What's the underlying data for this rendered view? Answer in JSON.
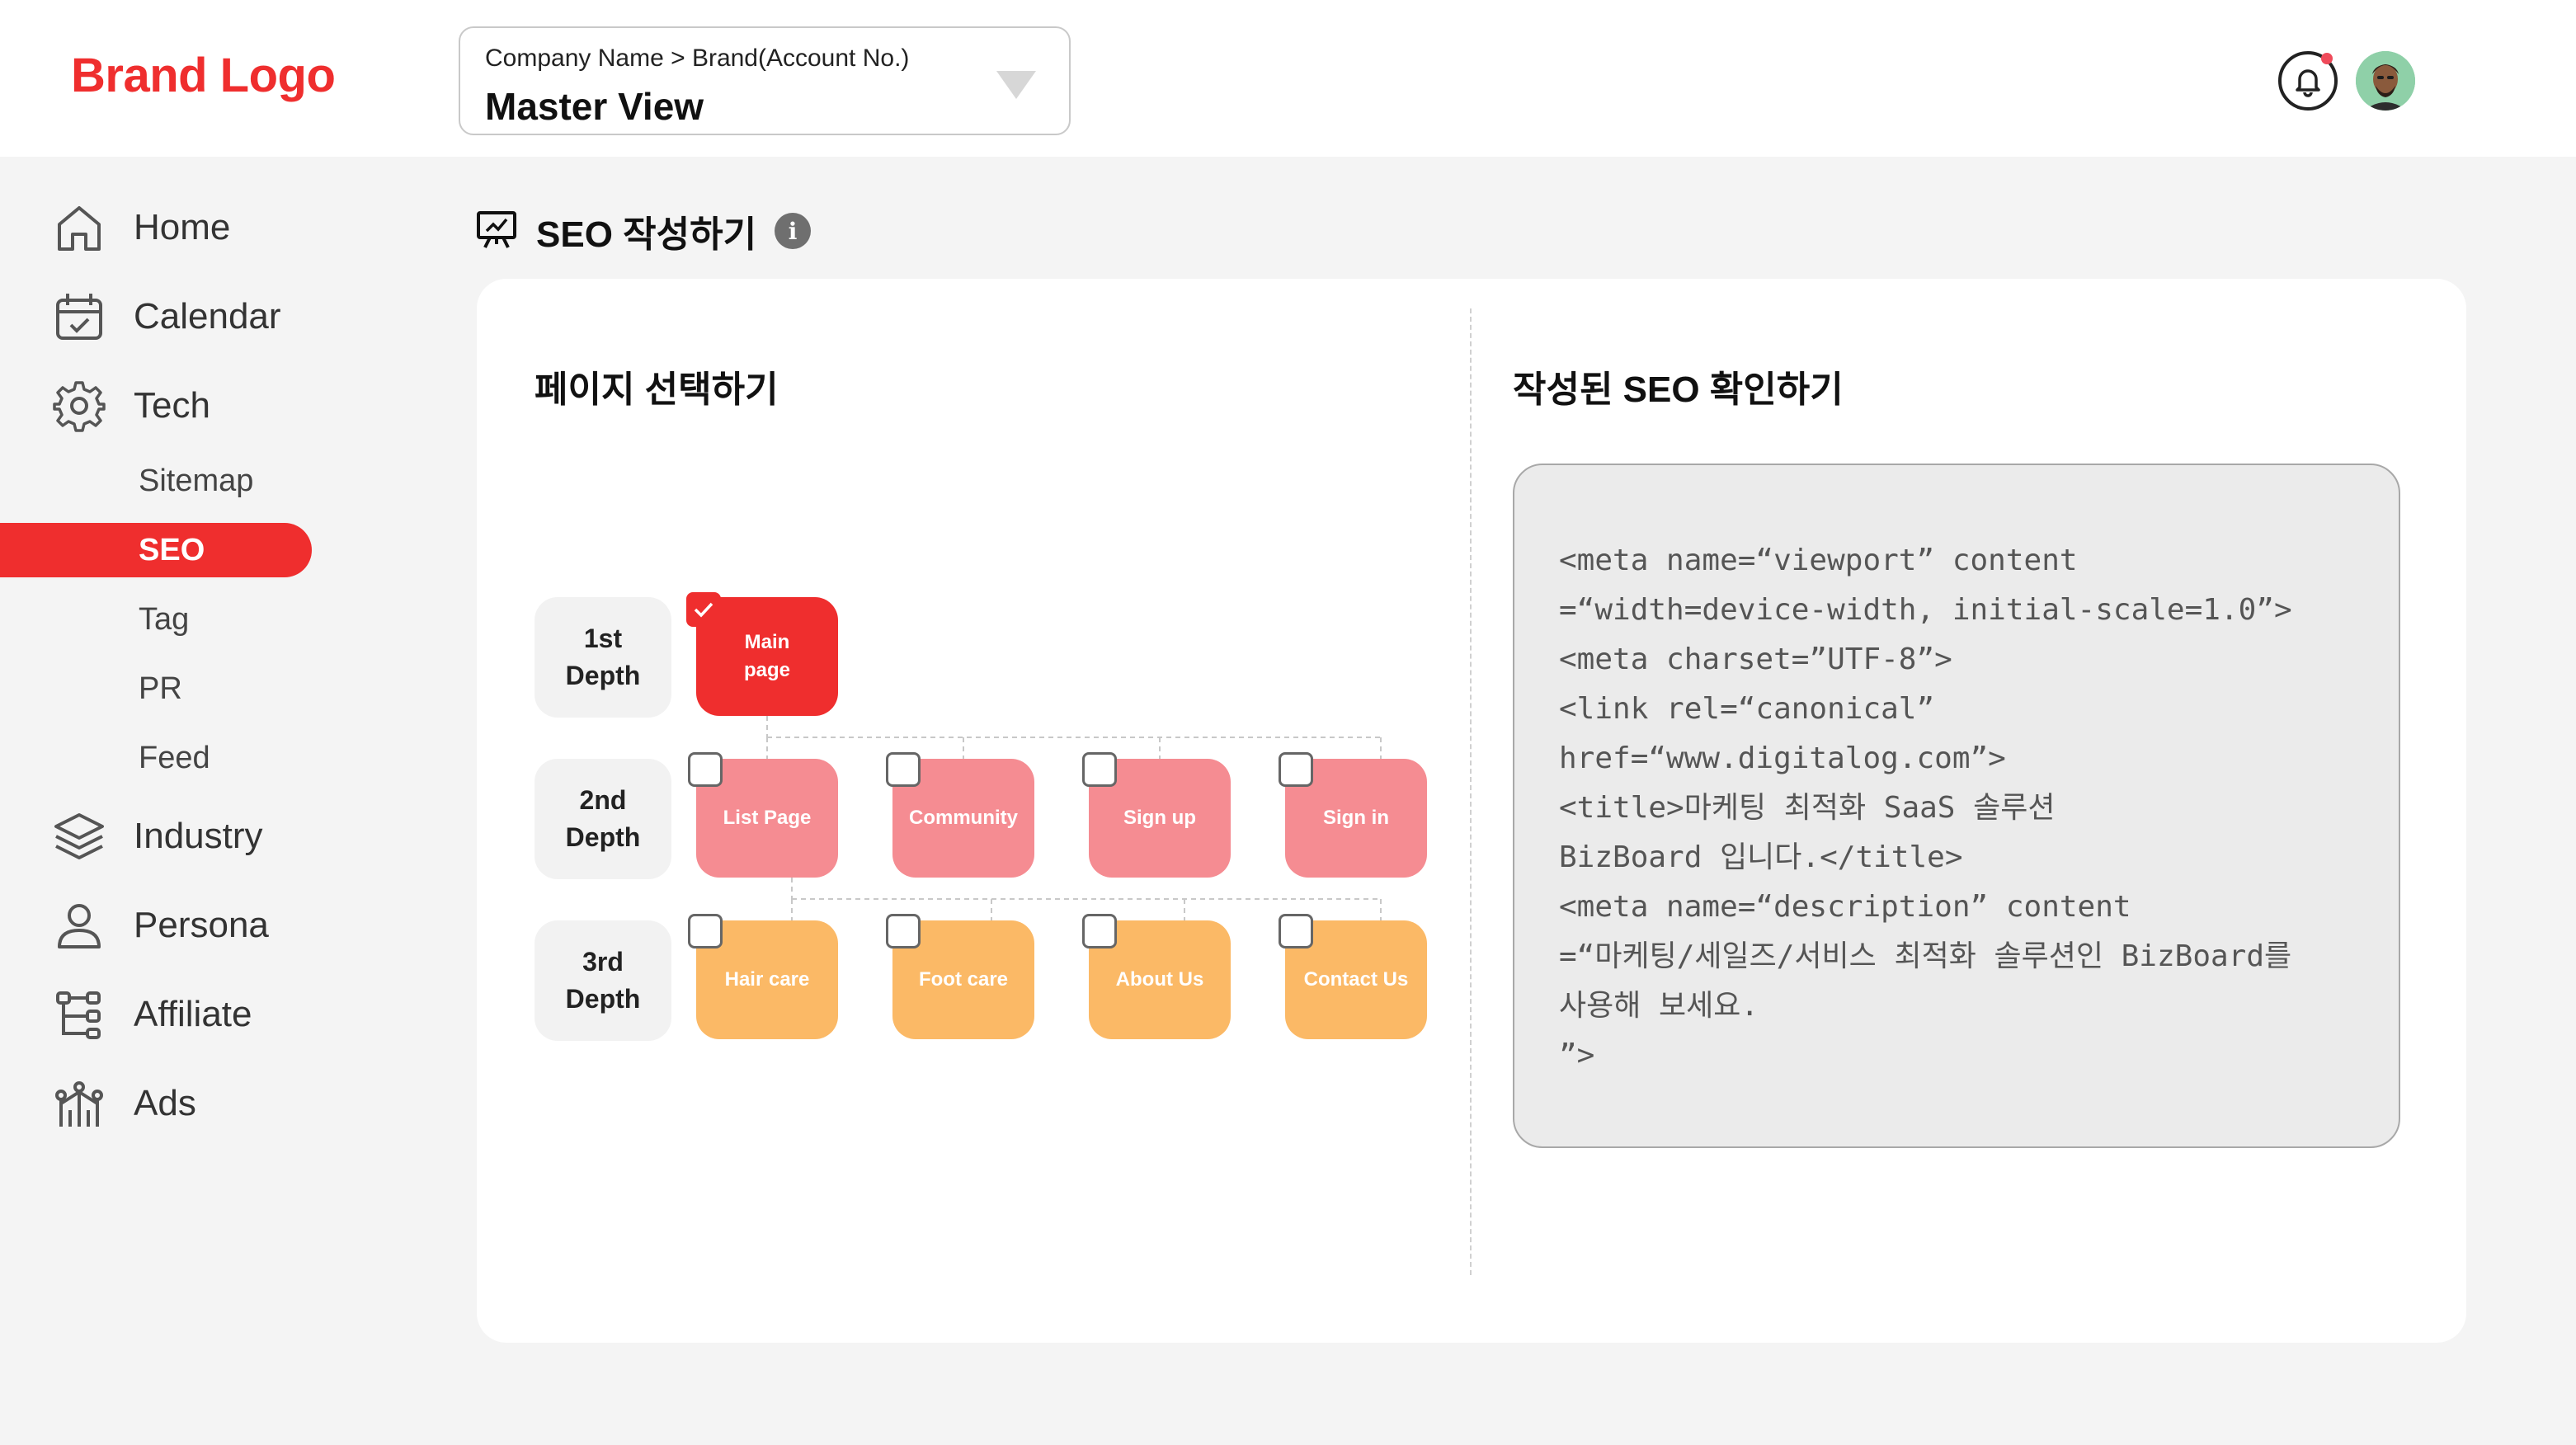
{
  "header": {
    "brand": "Brand Logo",
    "account_path": "Company Name > Brand(Account No.)",
    "account_view": "Master View",
    "notification_icon": "bell-icon",
    "avatar_icon": "user-avatar"
  },
  "sidebar": {
    "items": [
      {
        "label": "Home",
        "icon": "home-icon"
      },
      {
        "label": "Calendar",
        "icon": "calendar-icon"
      },
      {
        "label": "Tech",
        "icon": "gear-icon"
      },
      {
        "label": "Industry",
        "icon": "layers-icon"
      },
      {
        "label": "Persona",
        "icon": "person-icon"
      },
      {
        "label": "Affiliate",
        "icon": "hierarchy-icon"
      },
      {
        "label": "Ads",
        "icon": "antenna-icon"
      }
    ],
    "tech_sub": [
      "Sitemap",
      "SEO",
      "Tag",
      "PR",
      "Feed"
    ],
    "active_sub": "SEO"
  },
  "page": {
    "title": "SEO 작성하기",
    "info": "i",
    "title_icon": "presentation-icon"
  },
  "left_panel": {
    "title": "페이지 선택하기",
    "depths": [
      "1st\nDepth",
      "2nd\nDepth",
      "3rd\nDepth"
    ],
    "tree": {
      "depth1": [
        {
          "label": "Main\npage",
          "checked": true
        }
      ],
      "depth2": [
        {
          "label": "List Page",
          "checked": false
        },
        {
          "label": "Community",
          "checked": false
        },
        {
          "label": "Sign up",
          "checked": false
        },
        {
          "label": "Sign in",
          "checked": false
        }
      ],
      "depth3": [
        {
          "label": "Hair care",
          "checked": false
        },
        {
          "label": "Foot care",
          "checked": false
        },
        {
          "label": "About Us",
          "checked": false
        },
        {
          "label": "Contact Us",
          "checked": false
        }
      ]
    }
  },
  "right_panel": {
    "title": "작성된 SEO 확인하기",
    "code_lines": [
      "<meta name=“viewport” content",
      "=“width=device-width, initial-scale=1.0”>",
      "<meta charset=”UTF-8”>",
      "<link rel=“canonical”",
      "href=“www.digitalog.com”>",
      "<title>마케팅 최적화 SaaS 솔루션",
      "BizBoard 입니다.</title>",
      "<meta name=“description” content",
      "=“마케팅/세일즈/서비스 최적화 솔루션인 BizBoard를",
      "사용해 보세요.",
      "”>"
    ]
  },
  "colors": {
    "accent": "#ef2e2e",
    "depth2": "#f58c92",
    "depth3": "#fbb966",
    "background": "#f4f4f4"
  }
}
